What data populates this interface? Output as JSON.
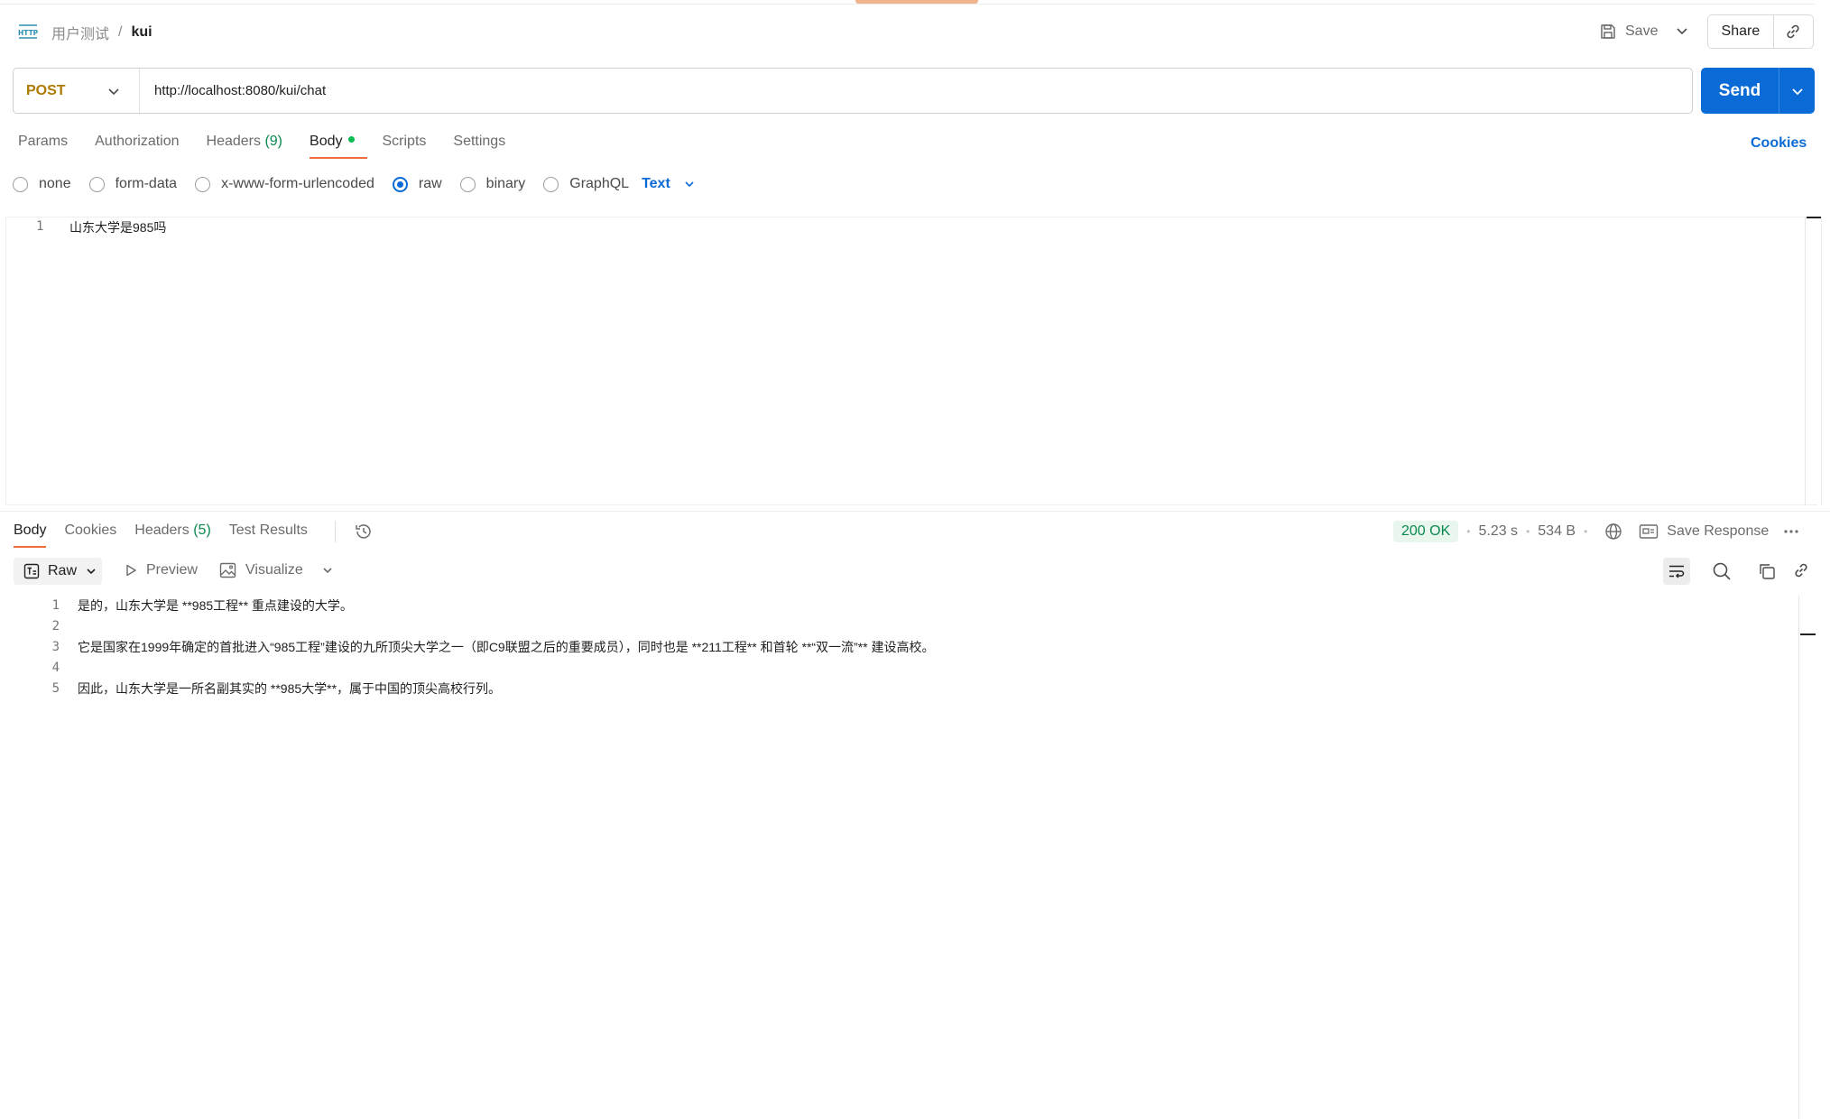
{
  "header": {
    "collection": "用户测试",
    "separator": "/",
    "request_name": "kui",
    "save_label": "Save",
    "share_label": "Share"
  },
  "request": {
    "method": "POST",
    "url": "http://localhost:8080/kui/chat",
    "send_label": "Send"
  },
  "request_tabs": [
    {
      "label": "Params"
    },
    {
      "label": "Authorization"
    },
    {
      "label": "Headers",
      "count": "(9)"
    },
    {
      "label": "Body",
      "active": true
    },
    {
      "label": "Scripts"
    },
    {
      "label": "Settings"
    }
  ],
  "cookies_label": "Cookies",
  "body_types": {
    "options": [
      "none",
      "form-data",
      "x-www-form-urlencoded",
      "raw",
      "binary",
      "GraphQL"
    ],
    "selected": "raw",
    "format": "Text"
  },
  "editor": {
    "lines": [
      {
        "num": "1",
        "text": "山东大学是985吗"
      }
    ]
  },
  "response_tabs": [
    {
      "label": "Body",
      "active": true
    },
    {
      "label": "Cookies"
    },
    {
      "label": "Headers",
      "count": "(5)"
    },
    {
      "label": "Test Results"
    }
  ],
  "response_status": {
    "status": "200 OK",
    "time": "5.23 s",
    "size": "534 B",
    "save_response_label": "Save Response"
  },
  "response_toolbar": {
    "raw_label": "Raw",
    "preview_label": "Preview",
    "visualize_label": "Visualize"
  },
  "response_body": {
    "lines": [
      {
        "num": "1",
        "text": "是的，山东大学是 **985工程** 重点建设的大学。"
      },
      {
        "num": "2",
        "text": ""
      },
      {
        "num": "3",
        "text": "它是国家在1999年确定的首批进入“985工程”建设的九所顶尖大学之一（即C9联盟之后的重要成员），同时也是 **211工程** 和首轮 **“双一流”** 建设高校。"
      },
      {
        "num": "4",
        "text": ""
      },
      {
        "num": "5",
        "text": "因此，山东大学是一所名副其实的 **985大学**，属于中国的顶尖高校行列。"
      }
    ]
  },
  "colors": {
    "accent_orange": "#f26b3a",
    "send_blue": "#0b6bd6",
    "method_post": "#ad7a03",
    "status_ok": "#0a8a4f"
  }
}
